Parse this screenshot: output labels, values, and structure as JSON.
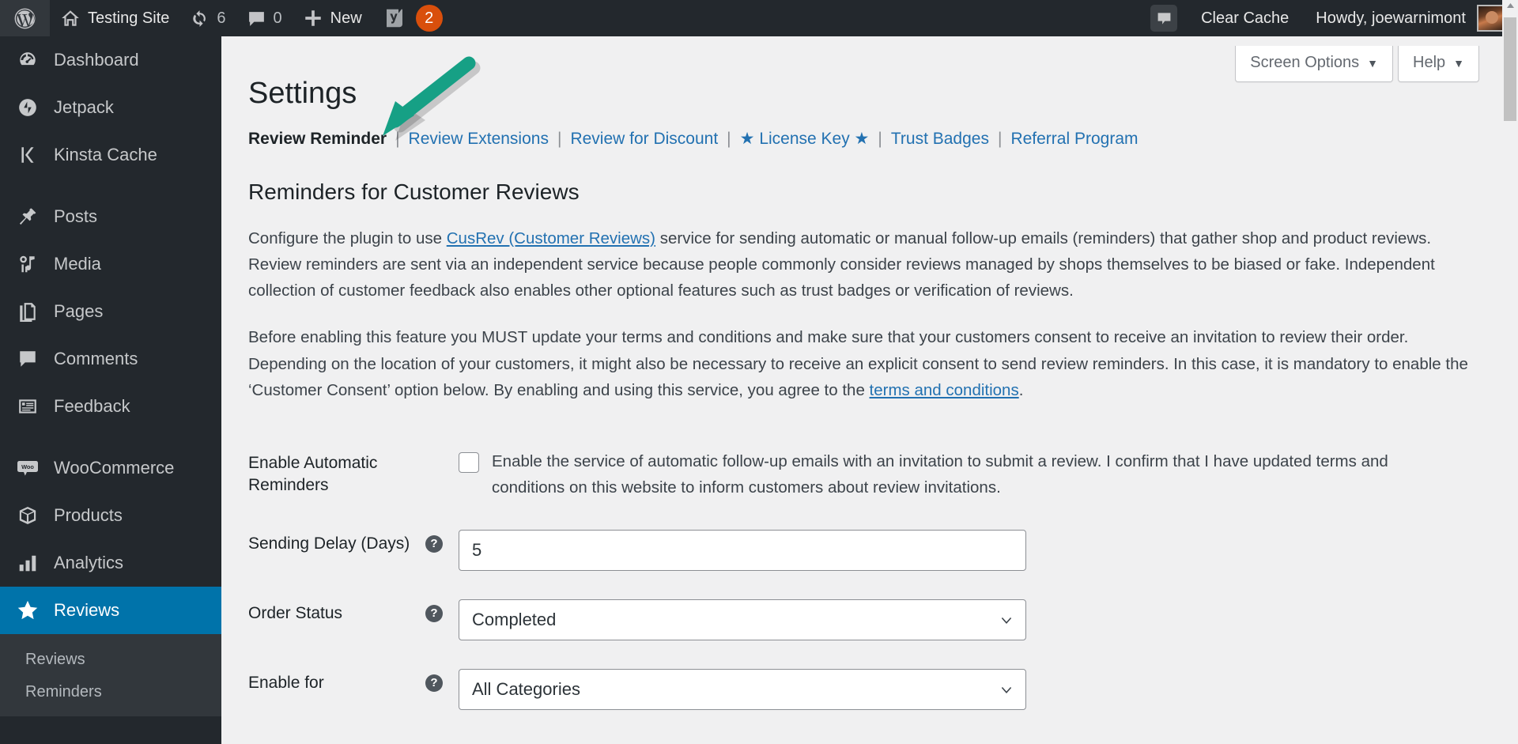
{
  "adminbar": {
    "wp_logo": "wordpress-logo",
    "site_name": "Testing Site",
    "updates_count": "6",
    "comments_count": "0",
    "new_label": "New",
    "yoast_count": "2",
    "clear_cache": "Clear Cache",
    "howdy": "Howdy, joewarnimont"
  },
  "sidebar": {
    "items": [
      {
        "label": "Dashboard",
        "icon": "dashboard-icon",
        "current": false,
        "gap_after": false
      },
      {
        "label": "Jetpack",
        "icon": "jetpack-icon",
        "current": false,
        "gap_after": false
      },
      {
        "label": "Kinsta Cache",
        "icon": "kinsta-icon",
        "current": false,
        "gap_after": true
      },
      {
        "label": "Posts",
        "icon": "pin-icon",
        "current": false,
        "gap_after": false
      },
      {
        "label": "Media",
        "icon": "media-icon",
        "current": false,
        "gap_after": false
      },
      {
        "label": "Pages",
        "icon": "pages-icon",
        "current": false,
        "gap_after": false
      },
      {
        "label": "Comments",
        "icon": "comments-icon",
        "current": false,
        "gap_after": false
      },
      {
        "label": "Feedback",
        "icon": "feedback-icon",
        "current": false,
        "gap_after": true
      },
      {
        "label": "WooCommerce",
        "icon": "woocommerce-icon",
        "current": false,
        "gap_after": false
      },
      {
        "label": "Products",
        "icon": "products-icon",
        "current": false,
        "gap_after": false
      },
      {
        "label": "Analytics",
        "icon": "analytics-icon",
        "current": false,
        "gap_after": false
      },
      {
        "label": "Reviews",
        "icon": "star-icon",
        "current": true,
        "gap_after": false
      }
    ],
    "submenu": [
      "Reviews",
      "Reminders"
    ]
  },
  "screen_meta": {
    "screen_options": "Screen Options",
    "help": "Help"
  },
  "page": {
    "title": "Settings",
    "section_title": "Reminders for Customer Reviews"
  },
  "tabs": [
    {
      "label": "Review Reminder",
      "current": true,
      "star": false
    },
    {
      "label": "Review Extensions",
      "current": false,
      "star": false
    },
    {
      "label": "Review for Discount",
      "current": false,
      "star": false
    },
    {
      "label": "License Key",
      "current": false,
      "star": true
    },
    {
      "label": "Trust Badges",
      "current": false,
      "star": false
    },
    {
      "label": "Referral Program",
      "current": false,
      "star": false
    }
  ],
  "paragraphs": {
    "p1_a": "Configure the plugin to use ",
    "p1_link": "CusRev (Customer Reviews)",
    "p1_b": " service for sending automatic or manual follow-up emails (reminders) that gather shop and product reviews. Review reminders are sent via an independent service because people commonly consider reviews managed by shops themselves to be biased or fake. Independent collection of customer feedback also enables other optional features such as trust badges or verification of reviews.",
    "p2_a": "Before enabling this feature you MUST update your terms and conditions and make sure that your customers consent to receive an invitation to review their order. Depending on the location of your customers, it might also be necessary to receive an explicit consent to send review reminders. In this case, it is mandatory to enable the ‘Customer Consent’ option below. By enabling and using this service, you agree to the ",
    "p2_link": "terms and conditions",
    "p2_b": "."
  },
  "fields": {
    "enable_auto": {
      "label": "Enable Automatic Reminders",
      "checkbox_text": "Enable the service of automatic follow-up emails with an invitation to submit a review. I confirm that I have updated terms and conditions on this website to inform customers about review invitations.",
      "checked": false,
      "has_help": false
    },
    "sending_delay": {
      "label": "Sending Delay (Days)",
      "value": "5",
      "has_help": true
    },
    "order_status": {
      "label": "Order Status",
      "value": "Completed",
      "options": [
        "Completed"
      ],
      "has_help": true
    },
    "enable_for": {
      "label": "Enable for",
      "value": "All Categories",
      "options": [
        "All Categories"
      ],
      "has_help": true
    }
  },
  "annotation": {
    "color": "#16a085",
    "type": "arrow",
    "points_to": "Review Reminder"
  },
  "colors": {
    "adminbar_bg": "#23282d",
    "sidebar_bg": "#23282d",
    "current_menu": "#0073aa",
    "link": "#2271b1",
    "content_bg": "#f0f0f1",
    "badge": "#d94f0c"
  }
}
